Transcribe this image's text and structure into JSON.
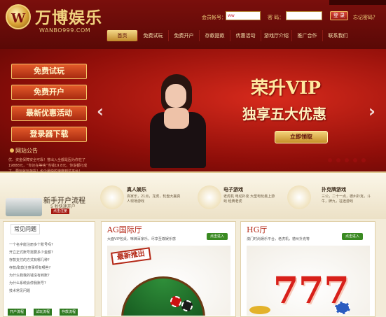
{
  "header": {
    "logo_char": "W",
    "brand": "万博娱乐",
    "url": "WANBO999.COM",
    "login": {
      "account_label": "会员帐号：",
      "account_value": "ww",
      "password_label": "密  码：",
      "login_button": "登 录",
      "forgot": "忘记密码？"
    },
    "nav": [
      "首页",
      "免费试玩",
      "免费开户",
      "存款提款",
      "优惠活动",
      "游戏厅介绍",
      "推广合作",
      "联系我们"
    ],
    "nav_active": 0
  },
  "sidebar_buttons": [
    "免费试玩",
    "免费开户",
    "最新优惠活动",
    "登录器下载"
  ],
  "notice": {
    "title": "网站公告",
    "body": "优、资金保障安全可靠！誉出入全都是因为你在了19888元，“你还在等啥”当钱19.8元，你说都打成了，要玩就玩存提！也个最快的速度到达平台！"
  },
  "banner": {
    "vip_line1": "荣升VIP",
    "vip_line2": "独享五大优惠",
    "vip_button": "立即领取"
  },
  "features": {
    "flow_title": "新手开户流程",
    "flow_sub": "5 秒快速开户",
    "flow_button": "点击注册",
    "items": [
      {
        "title": "真人娱乐",
        "desc": "百家乐，21点，龙虎，轮盘大赢真人现场游戏"
      },
      {
        "title": "电子游戏",
        "desc": "老虎机 电动扑克 大型电玩最上游戏 经典老虎"
      },
      {
        "title": "扑克牌游戏",
        "desc": "三公，二十一点，德州扑克，斗牛，牌九，征途游戏"
      }
    ]
  },
  "faq": {
    "title": "常见问题",
    "items": [
      "一个名字能注册多个账号吗?",
      "开立正式账号需要多少金额?",
      "存款支付的方式有哪几种?",
      "存款/取款注意事项有哪些?",
      "为什么我我的钱没有到账?",
      "为什么系统会停我账号?",
      "技术常见问题"
    ],
    "buttons": [
      "开户流程",
      "试玩流程",
      "存款流程"
    ]
  },
  "panels": [
    {
      "title": "AG国际厅",
      "desc": "大面VIP包桌，咪牌百家乐，尽享至尊娱乐感",
      "button": "点击进入",
      "stamp": "最新推出"
    },
    {
      "title": "HG厅",
      "desc": "澳门时尚娱乐平台，老虎机，德州扑克等",
      "button": "点击进入",
      "sevens": "777"
    }
  ]
}
